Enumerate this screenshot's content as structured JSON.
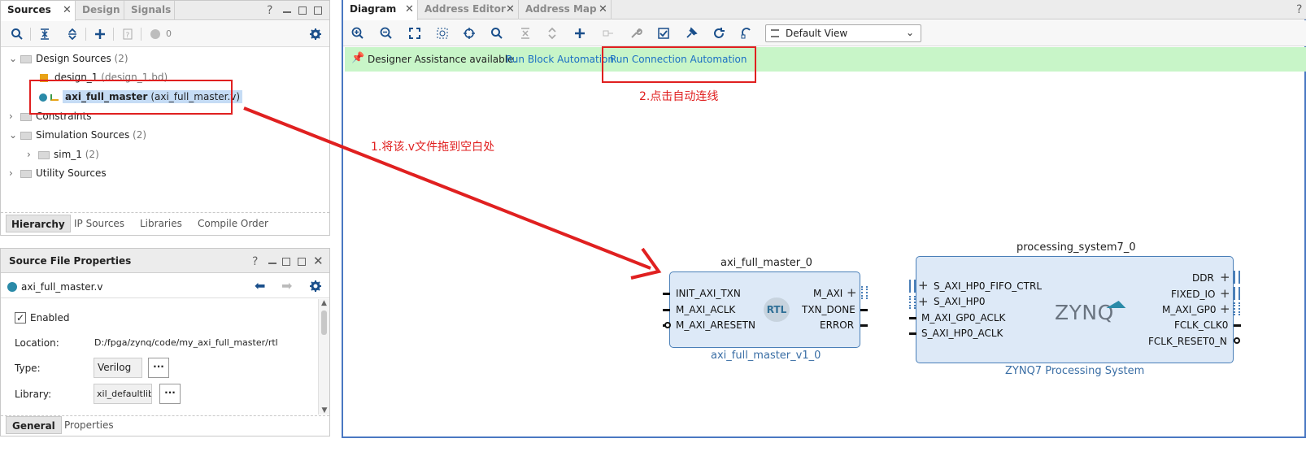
{
  "left_tabs": {
    "sources": "Sources",
    "design": "Design",
    "signals": "Signals"
  },
  "sources_toolbar": {
    "count": "0"
  },
  "tree": {
    "design_sources": "Design Sources",
    "design_sources_count": "(2)",
    "design_1": "design_1",
    "design_1_file": "(design_1.bd)",
    "axi_full_master": "axi_full_master",
    "axi_full_master_file": "(axi_full_master.v)",
    "constraints": "Constraints",
    "simulation_sources": "Simulation Sources",
    "simulation_sources_count": "(2)",
    "sim_1": "sim_1",
    "sim_1_count": "(2)",
    "utility_sources": "Utility Sources"
  },
  "sources_bottom_tabs": [
    "Hierarchy",
    "IP Sources",
    "Libraries",
    "Compile Order"
  ],
  "props": {
    "title": "Source File Properties",
    "file": "axi_full_master.v",
    "enabled_label": "Enabled",
    "location_label": "Location:",
    "location_value": "D:/fpga/zynq/code/my_axi_full_master/rtl",
    "type_label": "Type:",
    "type_value": "Verilog",
    "library_label": "Library:",
    "library_value": "xil_defaultlib",
    "tabs": [
      "General",
      "Properties"
    ]
  },
  "right_tabs": {
    "diagram": "Diagram",
    "address_editor": "Address Editor",
    "address_map": "Address Map"
  },
  "diagram_toolbar": {
    "view_select": "Default View"
  },
  "assist": {
    "text": "Designer Assistance available.",
    "block_link": "Run Block Automation",
    "conn_link": "Run Connection Automation"
  },
  "annotations": {
    "step2": "2.点击自动连线",
    "step1": "1.将该.v文件拖到空白处"
  },
  "axi_block": {
    "instance": "axi_full_master_0",
    "ip_name": "axi_full_master_v1_0",
    "left_ports": [
      "INIT_AXI_TXN",
      "M_AXI_ACLK",
      "M_AXI_ARESETN"
    ],
    "right_ports": [
      "M_AXI",
      "TXN_DONE",
      "ERROR"
    ],
    "badge": "RTL"
  },
  "zynq_block": {
    "instance": "processing_system7_0",
    "ip_name": "ZYNQ7 Processing System",
    "logo": "ZYNQ",
    "left_ports": [
      "S_AXI_HP0_FIFO_CTRL",
      "S_AXI_HP0",
      "M_AXI_GP0_ACLK",
      "S_AXI_HP0_ACLK"
    ],
    "right_ports": [
      "DDR",
      "FIXED_IO",
      "M_AXI_GP0",
      "FCLK_CLK0",
      "FCLK_RESET0_N"
    ]
  },
  "colors": {
    "accent": "#1a6fc4",
    "annotation": "#e02020",
    "assist_bg": "#c8f5c8",
    "block_fill": "#dde9f7",
    "block_border": "#4a7fb8"
  }
}
